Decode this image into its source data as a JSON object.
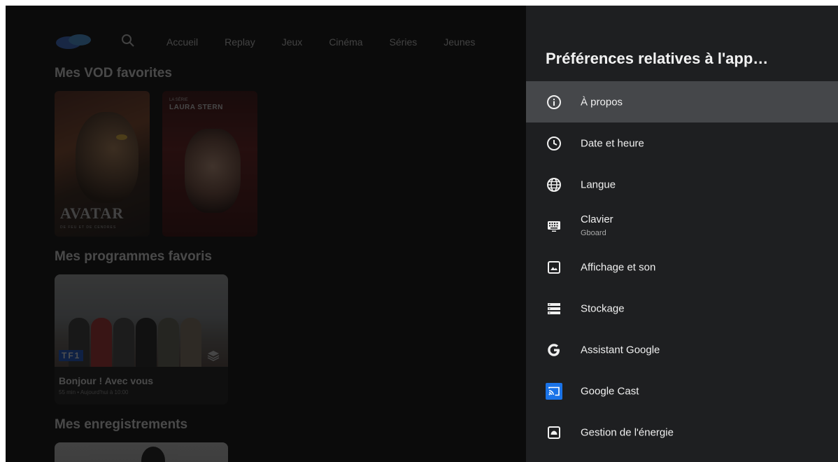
{
  "background_app": {
    "nav": {
      "items": [
        "Accueil",
        "Replay",
        "Jeux",
        "Cinéma",
        "Séries",
        "Jeunes"
      ]
    },
    "sections": {
      "vod_title": "Mes VOD favorites",
      "programs_title": "Mes programmes favoris",
      "recordings_title": "Mes enregistrements"
    },
    "vod_posters": {
      "avatar_title": "AVATAR",
      "avatar_sub": "DE FEU ET DE CENDRES",
      "laura_name": "LAURA STERN",
      "laura_kicker": "LA SÉRIE"
    },
    "program_card": {
      "channel": "TF1",
      "name": "Bonjour ! Avec vous",
      "meta": "55 min • Aujourd'hui à 10:00"
    }
  },
  "panel": {
    "title": "Préférences relatives à l'app…",
    "items": [
      {
        "label": "À propos",
        "icon": "info-icon"
      },
      {
        "label": "Date et heure",
        "icon": "clock-icon"
      },
      {
        "label": "Langue",
        "icon": "globe-icon"
      },
      {
        "label": "Clavier",
        "sublabel": "Gboard",
        "icon": "keyboard-icon"
      },
      {
        "label": "Affichage et son",
        "icon": "display-icon"
      },
      {
        "label": "Stockage",
        "icon": "storage-icon"
      },
      {
        "label": "Assistant Google",
        "icon": "google-g-icon"
      },
      {
        "label": "Google Cast",
        "icon": "cast-icon"
      },
      {
        "label": "Gestion de l'énergie",
        "icon": "energy-icon"
      }
    ],
    "focused_index": 0
  },
  "colors": {
    "panel_bg": "#1e1f21",
    "focus_bg": "#45474a",
    "cast_blue": "#1a73e8",
    "tf1_blue": "#1a5bd6"
  }
}
